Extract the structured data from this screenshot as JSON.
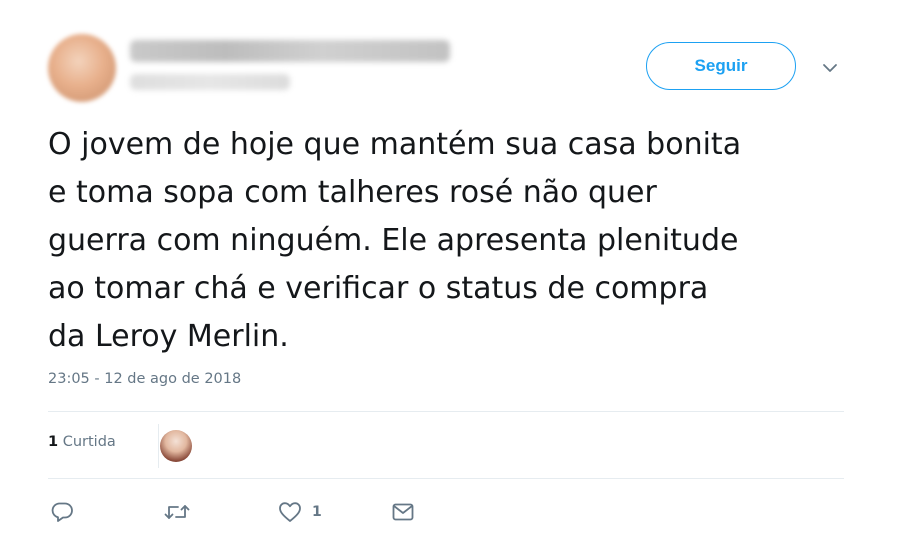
{
  "header": {
    "follow_label": "Seguir"
  },
  "tweet": {
    "text": "O jovem de hoje que mantém sua casa bonita\ne toma sopa com talheres rosé não quer\nguerra com ninguém. Ele apresenta plenitude\nao tomar chá e verificar o status de compra\nda Leroy Merlin.",
    "timestamp": "23:05 - 12 de ago de 2018"
  },
  "stats": {
    "likes_count": "1",
    "likes_label": "Curtida"
  },
  "actions": {
    "like_count": "1"
  },
  "colors": {
    "accent": "#1da1f2",
    "text": "#14171a",
    "muted": "#657786",
    "divider": "#e6ecf0"
  },
  "icons": [
    "chevron-down-icon",
    "reply-icon",
    "retweet-icon",
    "like-icon",
    "direct-message-icon"
  ]
}
